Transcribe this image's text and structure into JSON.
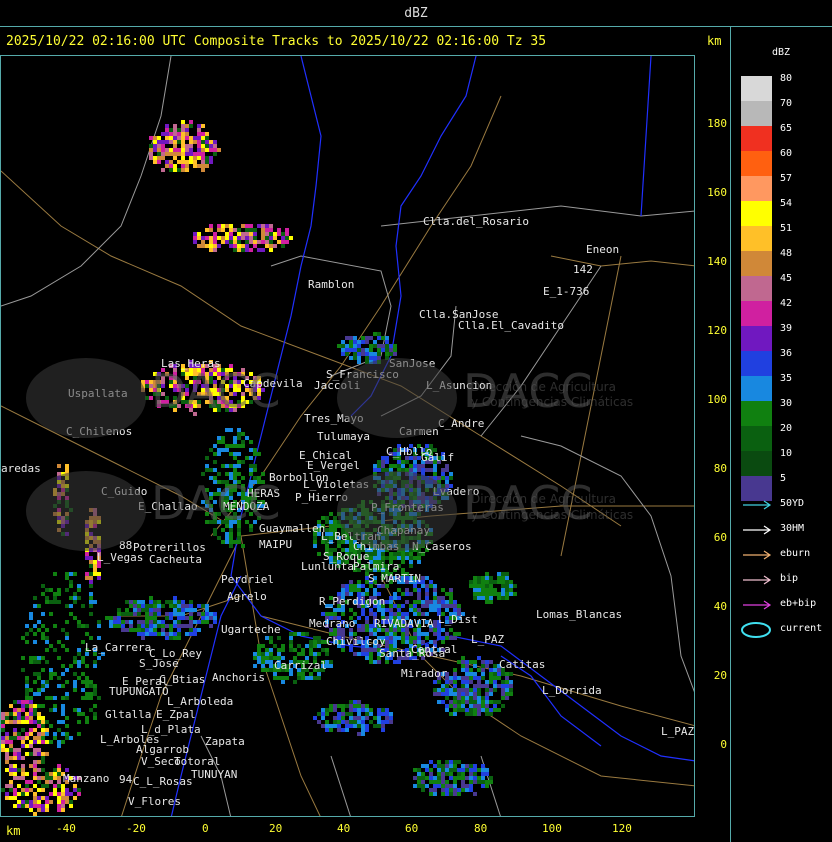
{
  "top_title": "dBZ",
  "header": "2025/10/22 02:16:00 UTC Composite Tracks to 2025/10/22 02:16:00 Tz 35",
  "km_label": "km",
  "y_ticks": [
    "180",
    "160",
    "140",
    "120",
    "100",
    "80",
    "60",
    "40",
    "20",
    "0"
  ],
  "x_ticks": [
    "-40",
    "-20",
    "0",
    "20",
    "40",
    "60",
    "80",
    "100",
    "120"
  ],
  "scale": {
    "title": "dBZ",
    "bins": [
      {
        "label": "80",
        "color": "#d8d8d8"
      },
      {
        "label": "70",
        "color": "#b8b8b8"
      },
      {
        "label": "65",
        "color": "#f03020"
      },
      {
        "label": "60",
        "color": "#ff6010"
      },
      {
        "label": "57",
        "color": "#ff9860"
      },
      {
        "label": "54",
        "color": "#ffff00"
      },
      {
        "label": "51",
        "color": "#ffc028"
      },
      {
        "label": "48",
        "color": "#d08838"
      },
      {
        "label": "45",
        "color": "#c06890"
      },
      {
        "label": "42",
        "color": "#d020a0"
      },
      {
        "label": "39",
        "color": "#7018c0"
      },
      {
        "label": "36",
        "color": "#2040e0"
      },
      {
        "label": "35",
        "color": "#1888e0"
      },
      {
        "label": "30",
        "color": "#108010"
      },
      {
        "label": "20",
        "color": "#0a6010"
      },
      {
        "label": "10",
        "color": "#0a4a10"
      },
      {
        "label": "5",
        "color": "#483890"
      }
    ]
  },
  "legend": [
    {
      "label": "50YD",
      "color": "#40d0e0",
      "type": "arrow"
    },
    {
      "label": "30HM",
      "color": "#ffffff",
      "type": "arrow"
    },
    {
      "label": "eburn",
      "color": "#f0b070",
      "type": "arrow"
    },
    {
      "label": "bip",
      "color": "#f0c0d0",
      "type": "arrow"
    },
    {
      "label": "eb+bip",
      "color": "#e040e0",
      "type": "arrow"
    },
    {
      "label": "current",
      "color": "#40e0f0",
      "type": "ellipse"
    }
  ],
  "watermark": {
    "brand": "DACC",
    "line1": "Dirección de Agricultura",
    "line2": "y Contingencias Climáticas"
  },
  "places": [
    {
      "name": "Clla.del_Rosario",
      "x": 422,
      "y": 220
    },
    {
      "name": "Eneon",
      "x": 585,
      "y": 248
    },
    {
      "name": "142",
      "x": 572,
      "y": 268
    },
    {
      "name": "E_1-736",
      "x": 542,
      "y": 290
    },
    {
      "name": "Ramblon",
      "x": 307,
      "y": 283
    },
    {
      "name": "Clla.SanJose",
      "x": 418,
      "y": 313
    },
    {
      "name": "Clla.El_Cavadito",
      "x": 457,
      "y": 324
    },
    {
      "name": "SanJose",
      "x": 388,
      "y": 362
    },
    {
      "name": "S_Francisco",
      "x": 325,
      "y": 373
    },
    {
      "name": "Jaccoli",
      "x": 313,
      "y": 384
    },
    {
      "name": "L_Asuncion",
      "x": 425,
      "y": 384
    },
    {
      "name": "Uspallata",
      "x": 67,
      "y": 392
    },
    {
      "name": "Las_Heras",
      "x": 160,
      "y": 362
    },
    {
      "name": "Capdevila",
      "x": 242,
      "y": 382
    },
    {
      "name": "Tres_Mayo",
      "x": 303,
      "y": 417
    },
    {
      "name": "C_Andre",
      "x": 437,
      "y": 422
    },
    {
      "name": "Carmen",
      "x": 398,
      "y": 430
    },
    {
      "name": "C_Chilenos",
      "x": 65,
      "y": 430
    },
    {
      "name": "Tulumaya",
      "x": 316,
      "y": 435
    },
    {
      "name": "C_Hbllo",
      "x": 385,
      "y": 450
    },
    {
      "name": "E_Chical",
      "x": 298,
      "y": 454
    },
    {
      "name": "Galif",
      "x": 420,
      "y": 456
    },
    {
      "name": "E_Vergel",
      "x": 306,
      "y": 464
    },
    {
      "name": "aredas",
      "x": 0,
      "y": 467
    },
    {
      "name": "Borbollon",
      "x": 268,
      "y": 476
    },
    {
      "name": "Lvadero",
      "x": 432,
      "y": 490
    },
    {
      "name": "C_Guido",
      "x": 100,
      "y": 490
    },
    {
      "name": "P_Hierro",
      "x": 294,
      "y": 496
    },
    {
      "name": "L_Violetas",
      "x": 302,
      "y": 483
    },
    {
      "name": "HERAS",
      "x": 246,
      "y": 492
    },
    {
      "name": "E_Challao",
      "x": 137,
      "y": 505
    },
    {
      "name": "MENDOZA",
      "x": 222,
      "y": 505
    },
    {
      "name": "P_Fronteras",
      "x": 370,
      "y": 506
    },
    {
      "name": "Guaymallen",
      "x": 258,
      "y": 527
    },
    {
      "name": "L_Beltran",
      "x": 320,
      "y": 535
    },
    {
      "name": "Chapanay",
      "x": 376,
      "y": 529
    },
    {
      "name": "MAIPU",
      "x": 258,
      "y": 543
    },
    {
      "name": "Chimbas",
      "x": 352,
      "y": 545
    },
    {
      "name": "N_Caseros",
      "x": 411,
      "y": 545
    },
    {
      "name": "88",
      "x": 118,
      "y": 544
    },
    {
      "name": "Potrerillos",
      "x": 132,
      "y": 546
    },
    {
      "name": "Cacheuta",
      "x": 148,
      "y": 558
    },
    {
      "name": "L_Vegas",
      "x": 96,
      "y": 556
    },
    {
      "name": "S_Roque",
      "x": 322,
      "y": 555
    },
    {
      "name": "Palmira",
      "x": 352,
      "y": 565
    },
    {
      "name": "Lunlunta",
      "x": 300,
      "y": 565
    },
    {
      "name": "S_MARTIN",
      "x": 367,
      "y": 577
    },
    {
      "name": "Perdriel",
      "x": 220,
      "y": 578
    },
    {
      "name": "Agrelo",
      "x": 226,
      "y": 595
    },
    {
      "name": "R_Perdigon",
      "x": 318,
      "y": 600
    },
    {
      "name": "L_Dist",
      "x": 437,
      "y": 618
    },
    {
      "name": "Lomas_Blancas",
      "x": 535,
      "y": 613
    },
    {
      "name": "Ugarteche",
      "x": 220,
      "y": 628
    },
    {
      "name": "Medrano",
      "x": 308,
      "y": 622
    },
    {
      "name": "RIVADAVIA",
      "x": 373,
      "y": 622
    },
    {
      "name": "L_PAZ",
      "x": 470,
      "y": 638
    },
    {
      "name": "La_Carrera",
      "x": 84,
      "y": 646
    },
    {
      "name": "C_Lo_Rey",
      "x": 148,
      "y": 652
    },
    {
      "name": "Chivilcoy",
      "x": 325,
      "y": 640
    },
    {
      "name": "Santa_Rosa",
      "x": 378,
      "y": 652
    },
    {
      "name": "Central",
      "x": 410,
      "y": 648
    },
    {
      "name": "Catitas",
      "x": 498,
      "y": 663
    },
    {
      "name": "S_Jose",
      "x": 138,
      "y": 662
    },
    {
      "name": "Carrizal",
      "x": 273,
      "y": 664
    },
    {
      "name": "Mirador",
      "x": 400,
      "y": 672
    },
    {
      "name": "Anchoris",
      "x": 211,
      "y": 676
    },
    {
      "name": "E_Peral",
      "x": 121,
      "y": 680
    },
    {
      "name": "C_Btias",
      "x": 158,
      "y": 678
    },
    {
      "name": "TUPUNGATO",
      "x": 108,
      "y": 690
    },
    {
      "name": "L_Dorrida",
      "x": 541,
      "y": 689
    },
    {
      "name": "L_Arboleda",
      "x": 166,
      "y": 700
    },
    {
      "name": "Gltalla",
      "x": 104,
      "y": 713
    },
    {
      "name": "E_Zpal",
      "x": 155,
      "y": 713
    },
    {
      "name": "L_d_Plata",
      "x": 140,
      "y": 728
    },
    {
      "name": "L_PAZ",
      "x": 660,
      "y": 730
    },
    {
      "name": "L_Arboles",
      "x": 99,
      "y": 738
    },
    {
      "name": "Zapata",
      "x": 204,
      "y": 740
    },
    {
      "name": "Algarrob",
      "x": 135,
      "y": 748
    },
    {
      "name": "V_Seco",
      "x": 140,
      "y": 760
    },
    {
      "name": "Totoral",
      "x": 173,
      "y": 760
    },
    {
      "name": "TUNUYAN",
      "x": 190,
      "y": 773
    },
    {
      "name": "Manzano",
      "x": 62,
      "y": 777
    },
    {
      "name": "94",
      "x": 118,
      "y": 778
    },
    {
      "name": "C_L_Rosas",
      "x": 132,
      "y": 780
    },
    {
      "name": "V_Flores",
      "x": 127,
      "y": 800
    }
  ]
}
